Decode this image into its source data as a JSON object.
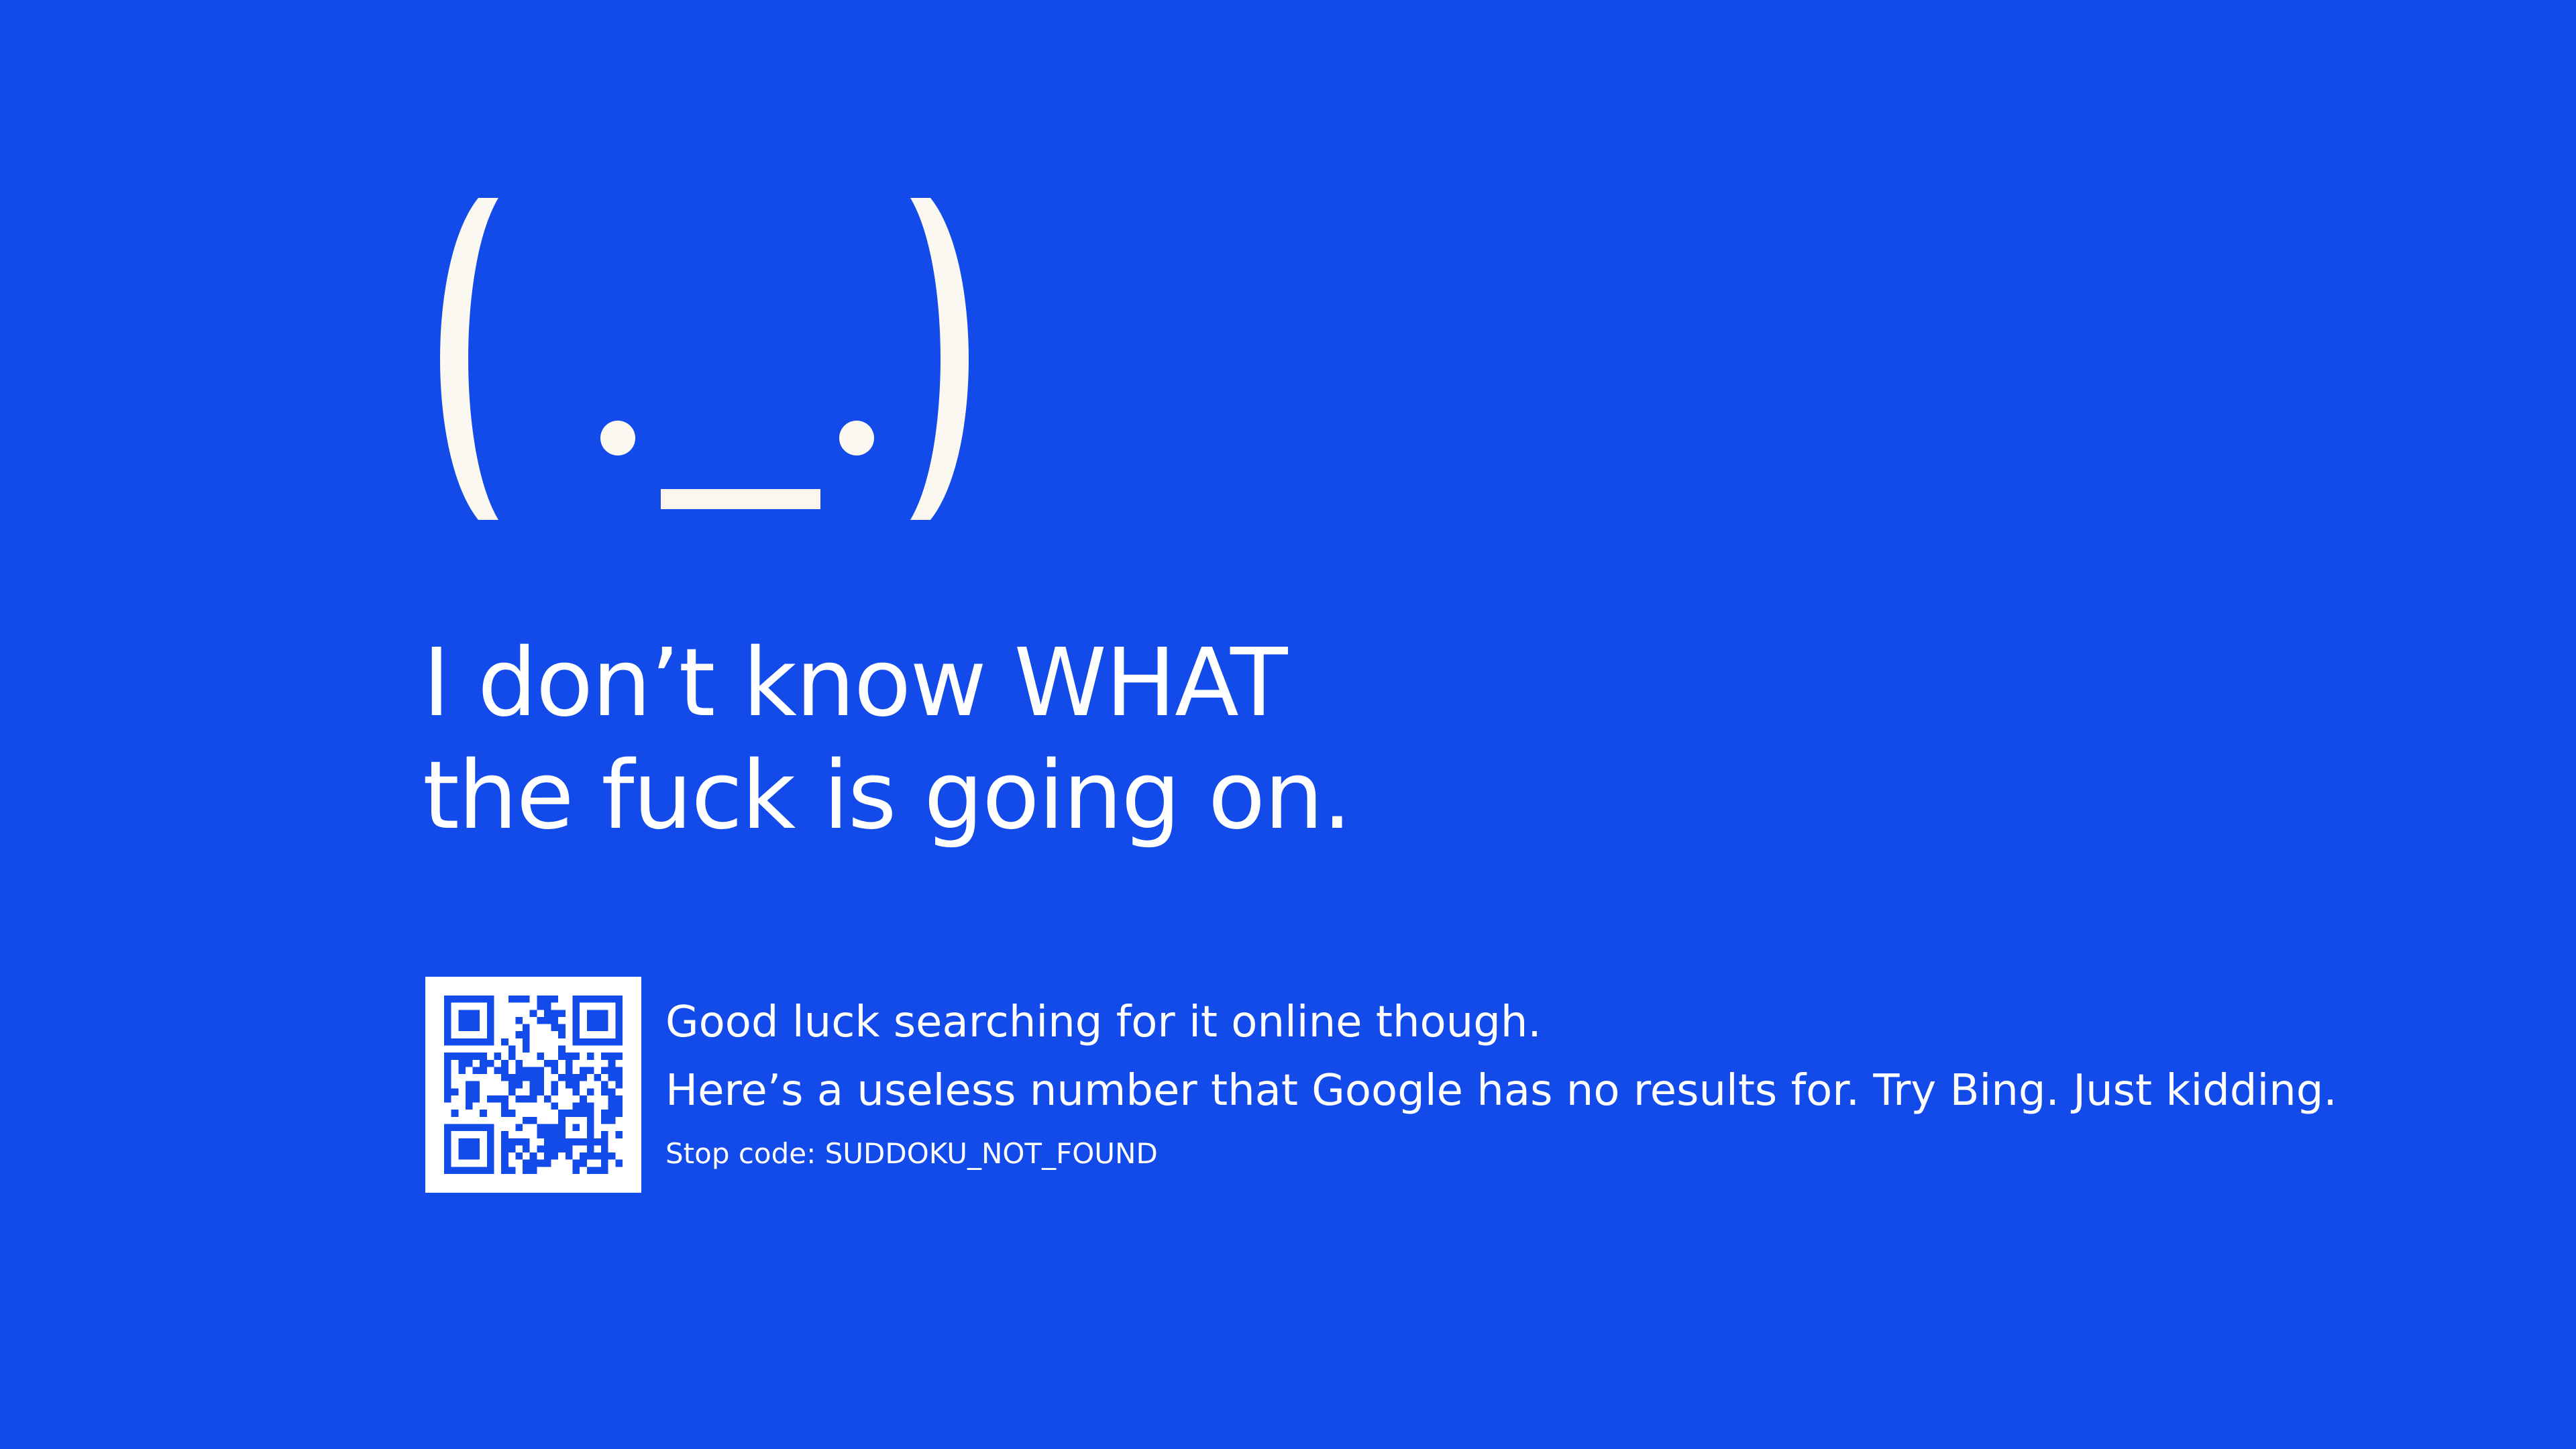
{
  "colors": {
    "background": "#124BEA",
    "foreground": "#FFFFFF",
    "face": "#FBF8F2"
  },
  "face": {
    "icon": "sad-face-emoticon"
  },
  "headline": {
    "line1": "I don’t know WHAT",
    "line2": "the fuck is going on."
  },
  "qr_code": {
    "icon": "qr-code-icon"
  },
  "info": {
    "line1": "Good luck searching for it online though.",
    "line2": "Here’s a useless number that Google has no results for. Try Bing. Just kidding.",
    "stop_code_label": "Stop code:",
    "stop_code_value": "SUDDOKU_NOT_FOUND"
  }
}
